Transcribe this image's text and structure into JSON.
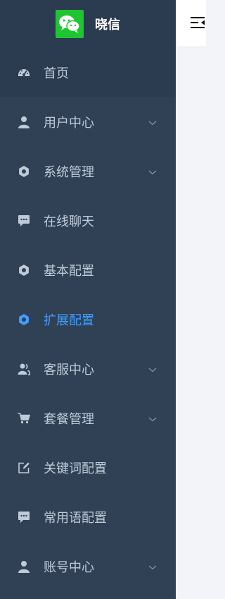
{
  "app": {
    "name": "晓信",
    "logo_icon": "wechat-logo-icon",
    "brand_color": "#1fc531"
  },
  "sidebar": {
    "background": "#304156",
    "active_color": "#409eff",
    "items": [
      {
        "label": "首页",
        "icon": "dashboard-icon",
        "has_submenu": false
      },
      {
        "label": "用户中心",
        "icon": "user-icon",
        "has_submenu": true
      },
      {
        "label": "系统管理",
        "icon": "gear-icon",
        "has_submenu": true
      },
      {
        "label": "在线聊天",
        "icon": "chat-icon",
        "has_submenu": false
      },
      {
        "label": "基本配置",
        "icon": "gear-icon",
        "has_submenu": false
      },
      {
        "label": "扩展配置",
        "icon": "gear-icon",
        "has_submenu": false,
        "active": true
      },
      {
        "label": "客服中心",
        "icon": "customer-service-icon",
        "has_submenu": true
      },
      {
        "label": "套餐管理",
        "icon": "cart-icon",
        "has_submenu": true
      },
      {
        "label": "关键词配置",
        "icon": "edit-icon",
        "has_submenu": false
      },
      {
        "label": "常用语配置",
        "icon": "chat-icon",
        "has_submenu": false
      },
      {
        "label": "账号中心",
        "icon": "user-icon",
        "has_submenu": true
      }
    ]
  },
  "header": {
    "toggle_icon": "menu-fold-icon"
  }
}
